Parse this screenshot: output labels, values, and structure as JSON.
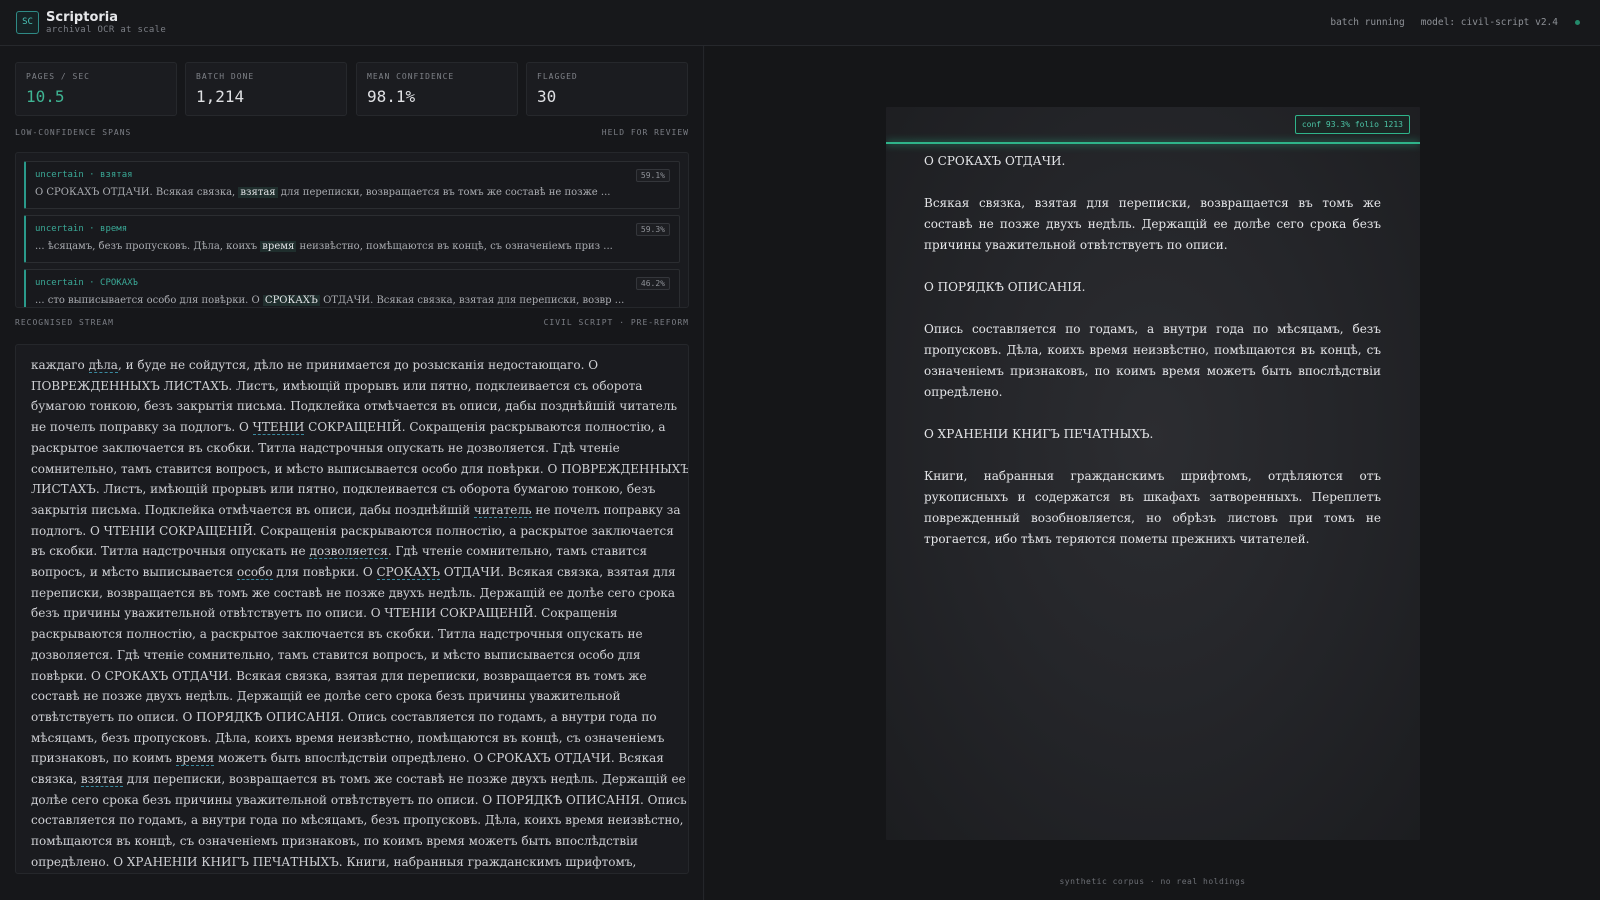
{
  "app": {
    "logo": "SC",
    "name": "Scriptoria",
    "tagline": "archival OCR at scale",
    "status": "batch running",
    "model": "model: civil-script v2.4"
  },
  "stats": [
    {
      "label": "PAGES / SEC",
      "value": "10.5"
    },
    {
      "label": "BATCH DONE",
      "value": "1,214"
    },
    {
      "label": "MEAN CONFIDENCE",
      "value": "98.1%"
    },
    {
      "label": "FLAGGED",
      "value": "30"
    }
  ],
  "review": {
    "title": "LOW-CONFIDENCE SPANS",
    "right": "HELD FOR REVIEW",
    "items": [
      {
        "tag": "uncertain · взятая",
        "pct": "59.1%",
        "before": "О СРОКАХЪ ОТДАЧИ. Всякая связка, ",
        "word": "взятая",
        "after": " для переписки, возвращается въ томъ же составѣ не позже ..."
      },
      {
        "tag": "uncertain · время",
        "pct": "59.3%",
        "before": "... ѣсяцамъ, безъ пропусковъ. Дѣла, коихъ ",
        "word": "время",
        "after": " неизвѣстно, помѣщаются въ концѣ, съ означеніемъ приз ..."
      },
      {
        "tag": "uncertain · СРОКАХЪ",
        "pct": "46.2%",
        "before": "... сто выписывается особо для повѣрки. О ",
        "word": "СРОКАХЪ",
        "after": " ОТДАЧИ. Всякая связка, взятая для переписки, возвр ..."
      }
    ]
  },
  "stream": {
    "title": "RECOGNISED STREAM",
    "right": "CIVIL SCRIPT · PRE-REFORM",
    "segments": [
      {
        "t": "каждаго "
      },
      {
        "t": "дѣла",
        "u": true
      },
      {
        "t": ", и буде не сойдутся, дѣло не принимается до розысканія недостающаго. О ПОВРЕЖДЕННЫХЪ ЛИСТАХЪ. Листъ, имѣющій прорывъ или пятно, подклеивается съ оборота бумагою тонкою, безъ закрытія письма. Подклейка отмѣчается въ описи, дабы позднѣйшій читатель не почелъ поправку за подлогъ. О "
      },
      {
        "t": "ЧТЕНІИ",
        "u": true
      },
      {
        "t": " СОКРАЩЕНІЙ. Сокращенія раскрываются полностію, а раскрытое заключается въ скобки. Титла надстрочныя опускать не дозволяется. Гдѣ чтеніе сомнительно, тамъ ставится вопросъ, и мѣсто выписывается особо для повѣрки. О ПОВРЕЖДЕННЫХЪ ЛИСТАХЪ. Листъ, имѣющій прорывъ или пятно, подклеивается съ оборота бумагою тонкою, безъ закрытія письма. Подклейка отмѣчается въ описи, дабы позднѣйшій "
      },
      {
        "t": "читатель",
        "u": true
      },
      {
        "t": " не почелъ поправку за подлогъ. О ЧТЕНІИ СОКРАЩЕНІЙ. Сокращенія раскрываются полностію, а раскрытое заключается въ скобки. Титла надстрочныя опускать не "
      },
      {
        "t": "дозволяется",
        "u": true
      },
      {
        "t": ". Гдѣ чтеніе сомнительно, тамъ ставится вопросъ, и мѣсто выписывается "
      },
      {
        "t": "особо",
        "u": true
      },
      {
        "t": " для повѣрки. О "
      },
      {
        "t": "СРОКАХЪ",
        "u": true
      },
      {
        "t": " ОТДАЧИ. Всякая связка, взятая для переписки, возвращается въ томъ же составѣ не позже двухъ недѣль. Держащій ее долѣе сего срока безъ причины уважительной отвѣтствуетъ по описи. О ЧТЕНІИ СОКРАЩЕНІЙ. Сокращенія раскрываются полностію, а раскрытое заключается въ скобки. Титла надстрочныя опускать не дозволяется. Гдѣ чтеніе сомнительно, тамъ ставится вопросъ, и мѣсто выписывается особо для повѣрки. О СРОКАХЪ ОТДАЧИ. Всякая связка, взятая для переписки, возвращается въ томъ же составѣ не позже двухъ недѣль. Держащій ее долѣе сего срока безъ причины уважительной отвѣтствуетъ по описи. О ПОРЯДКѢ ОПИСАНІЯ. Опись составляется по годамъ, а внутри года по мѣсяцамъ, безъ пропусковъ. Дѣла, коихъ время неизвѣстно, помѣщаются въ концѣ, съ означеніемъ признаковъ, по коимъ "
      },
      {
        "t": "время",
        "u": true
      },
      {
        "t": " можетъ быть впослѣдствіи опредѣлено. О СРОКАХЪ ОТДАЧИ. Всякая связка, "
      },
      {
        "t": "взятая",
        "u": true
      },
      {
        "t": " для переписки, возвращается въ томъ же составѣ не позже двухъ недѣль. Держащій ее долѣе сего срока безъ причины уважительной отвѣтствуетъ по описи. О ПОРЯДКѢ ОПИСАНІЯ. Опись составляется по годамъ, а внутри года по мѣсяцамъ, безъ пропусковъ. Дѣла, коихъ время неизвѣстно, помѣщаются въ концѣ, съ означеніемъ признаковъ, по коимъ время можетъ быть впослѣдствіи опредѣлено. О ХРАНЕНІИ КНИГЪ ПЕЧАТНЫХЪ. Книги, набранныя гражданскимъ шрифтомъ, отдѣляются отъ рукописныхъ и содержатся въ шкафахъ затворенныхъ. Переплетъ поврежденный возобновляется, но обрѣзъ листовъ при томъ не трогается, ибо тѣмъ теряются пометы прежнихъ читателей."
      }
    ]
  },
  "document": {
    "badge": "conf 93.3% folio 1213",
    "blocks": [
      {
        "kind": "h",
        "text": "О СРОКАХЪ ОТДАЧИ."
      },
      {
        "kind": "p",
        "text": "Всякая связка, взятая для переписки, возвращается въ томъ же составѣ не позже двухъ недѣль. Держащій ее долѣе сего срока безъ причины уважительной отвѣтствуетъ по описи."
      },
      {
        "kind": "h",
        "text": "О ПОРЯДКѢ ОПИСАНІЯ."
      },
      {
        "kind": "p",
        "text": "Опись составляется по годамъ, а внутри года по мѣсяцамъ, безъ пропусковъ. Дѣла, коихъ время неизвѣстно, помѣщаются въ концѣ, съ означеніемъ признаковъ, по коимъ время можетъ быть впослѣдствіи опредѣлено."
      },
      {
        "kind": "h",
        "text": "О ХРАНЕНІИ КНИГЪ ПЕЧАТНЫХЪ."
      },
      {
        "kind": "p",
        "text": "Книги, набранныя гражданскимъ шрифтомъ, отдѣляются отъ рукописныхъ и содержатся въ шкафахъ затворенныхъ. Переплетъ поврежденный возобновляется, но обрѣзъ листовъ при томъ не трогается, ибо тѣмъ теряются пометы прежнихъ читателей."
      }
    ]
  },
  "footer": "synthetic corpus · no real holdings",
  "colors": {
    "accent": "#3fb493",
    "scanline": "#2fb48a",
    "underline": "#3a8aa0"
  }
}
